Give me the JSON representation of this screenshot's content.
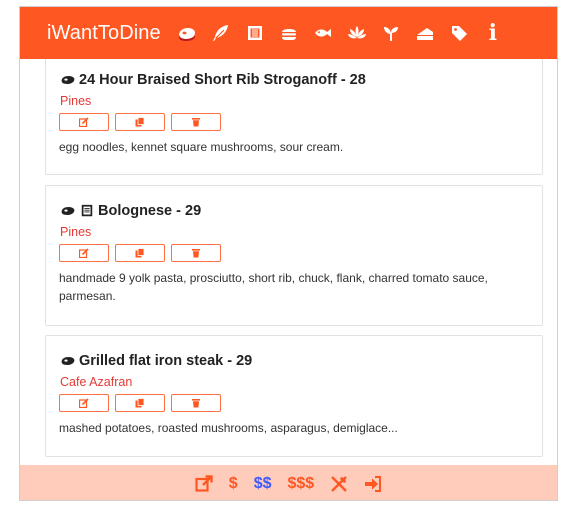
{
  "app": {
    "brand": "iWantToDine",
    "header_bg": "#ff5722",
    "nav_icons": [
      "steak-icon",
      "feather-icon",
      "noodle-icon",
      "burger-icon",
      "fish-icon",
      "lotus-icon",
      "sprout-icon",
      "cheese-icon",
      "tag-icon",
      "info-icon"
    ]
  },
  "dishes": [
    {
      "title": "24 Hour Braised Short Rib Stroganoff - 28",
      "restaurant": "Pines",
      "icons": [
        "steak-icon"
      ],
      "description": "egg noodles, kennet square mushrooms, sour cream."
    },
    {
      "title": "Bolognese - 29",
      "restaurant": "Pines",
      "icons": [
        "steak-icon",
        "noodle-icon"
      ],
      "description": "handmade 9 yolk pasta, prosciutto, short rib, chuck, flank, charred tomato sauce, parmesan."
    },
    {
      "title": "Grilled flat iron steak - 29",
      "restaurant": "Cafe Azafran",
      "icons": [
        "steak-icon"
      ],
      "description": "mashed potatoes, roasted mushrooms, asparagus, demiglace..."
    }
  ],
  "card_actions": [
    "edit-icon",
    "copy-icon",
    "delete-icon"
  ],
  "footer": {
    "bg": "#ffccbc",
    "price_1": "$",
    "price_2": "$$",
    "price_3": "$$$",
    "active_price": "$$",
    "icons": [
      "external-link-icon",
      "utensils-icon",
      "sign-in-icon"
    ]
  }
}
